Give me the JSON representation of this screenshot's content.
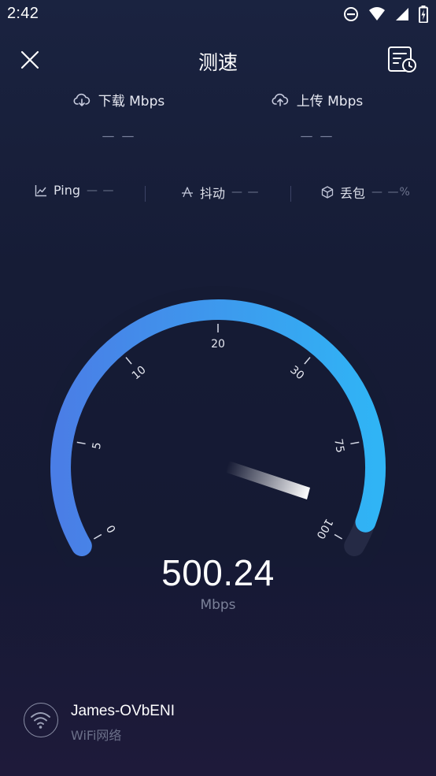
{
  "status": {
    "time": "2:42"
  },
  "header": {
    "title": "测速"
  },
  "rates": {
    "download": {
      "label": "下载 Mbps",
      "value": "— —"
    },
    "upload": {
      "label": "上传 Mbps",
      "value": "— —"
    }
  },
  "metrics": {
    "ping": {
      "label": "Ping",
      "value": "— —"
    },
    "jitter": {
      "label": "抖动",
      "value": "— —"
    },
    "loss": {
      "label": "丢包",
      "value": "— —%"
    }
  },
  "gauge": {
    "ticks": [
      "0",
      "5",
      "10",
      "20",
      "30",
      "75",
      "100"
    ],
    "speed_value": 500.24,
    "progress_fraction": 0.96
  },
  "speed": {
    "value": "500.24",
    "unit": "Mbps"
  },
  "network": {
    "name": "James-OVbENI",
    "type": "WiFi网络"
  },
  "colors": {
    "arc_start": "#4a7ee6",
    "arc_end": "#30b4f5",
    "background": "#161c36"
  }
}
